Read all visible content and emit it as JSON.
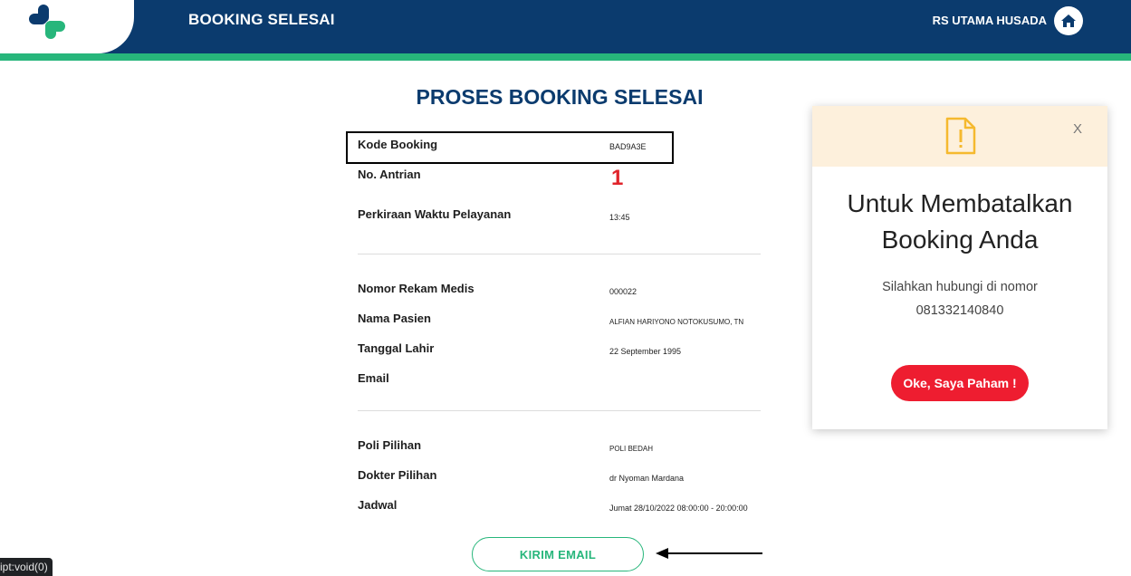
{
  "header": {
    "title": "BOOKING SELESAI",
    "hospital": "RS UTAMA HUSADA",
    "logo_icon": "medical-cross-logo",
    "home_icon": "home-icon"
  },
  "main": {
    "title": "PROSES BOOKING SELESAI",
    "booking": [
      {
        "label": "Kode Booking",
        "value": "BAD9A3E"
      },
      {
        "label": "No. Antrian",
        "value": "1"
      },
      {
        "label": "Perkiraan Waktu Pelayanan",
        "value": "13:45"
      }
    ],
    "patient": [
      {
        "label": "Nomor Rekam Medis",
        "value": "000022"
      },
      {
        "label": "Nama Pasien",
        "value": "ALFIAN HARIYONO NOTOKUSUMO, TN"
      },
      {
        "label": "Tanggal Lahir",
        "value": "22 September 1995"
      },
      {
        "label": "Email",
        "value": ""
      }
    ],
    "schedule": [
      {
        "label": "Poli Pilihan",
        "value": "POLI BEDAH"
      },
      {
        "label": "Dokter Pilihan",
        "value": "dr Nyoman Mardana"
      },
      {
        "label": "Jadwal",
        "value": "Jumat 28/10/2022 08:00:00 - 20:00:00"
      }
    ],
    "email_button": "KIRIM EMAIL"
  },
  "modal": {
    "icon": "warning-document-icon",
    "close": "X",
    "title_line1": "Untuk Membatalkan",
    "title_line2": "Booking Anda",
    "text_line1": "Silahkan hubungi di nomor",
    "text_line2": "081332140840",
    "button": "Oke, Saya Paham !"
  },
  "status_bar": "ipt:void(0)",
  "colors": {
    "navy": "#0b3b6e",
    "green": "#27b67b",
    "red": "#ee1d30",
    "queue_red": "#e0242b",
    "modal_header": "#fdf0dc",
    "warning": "#f5b92e"
  }
}
